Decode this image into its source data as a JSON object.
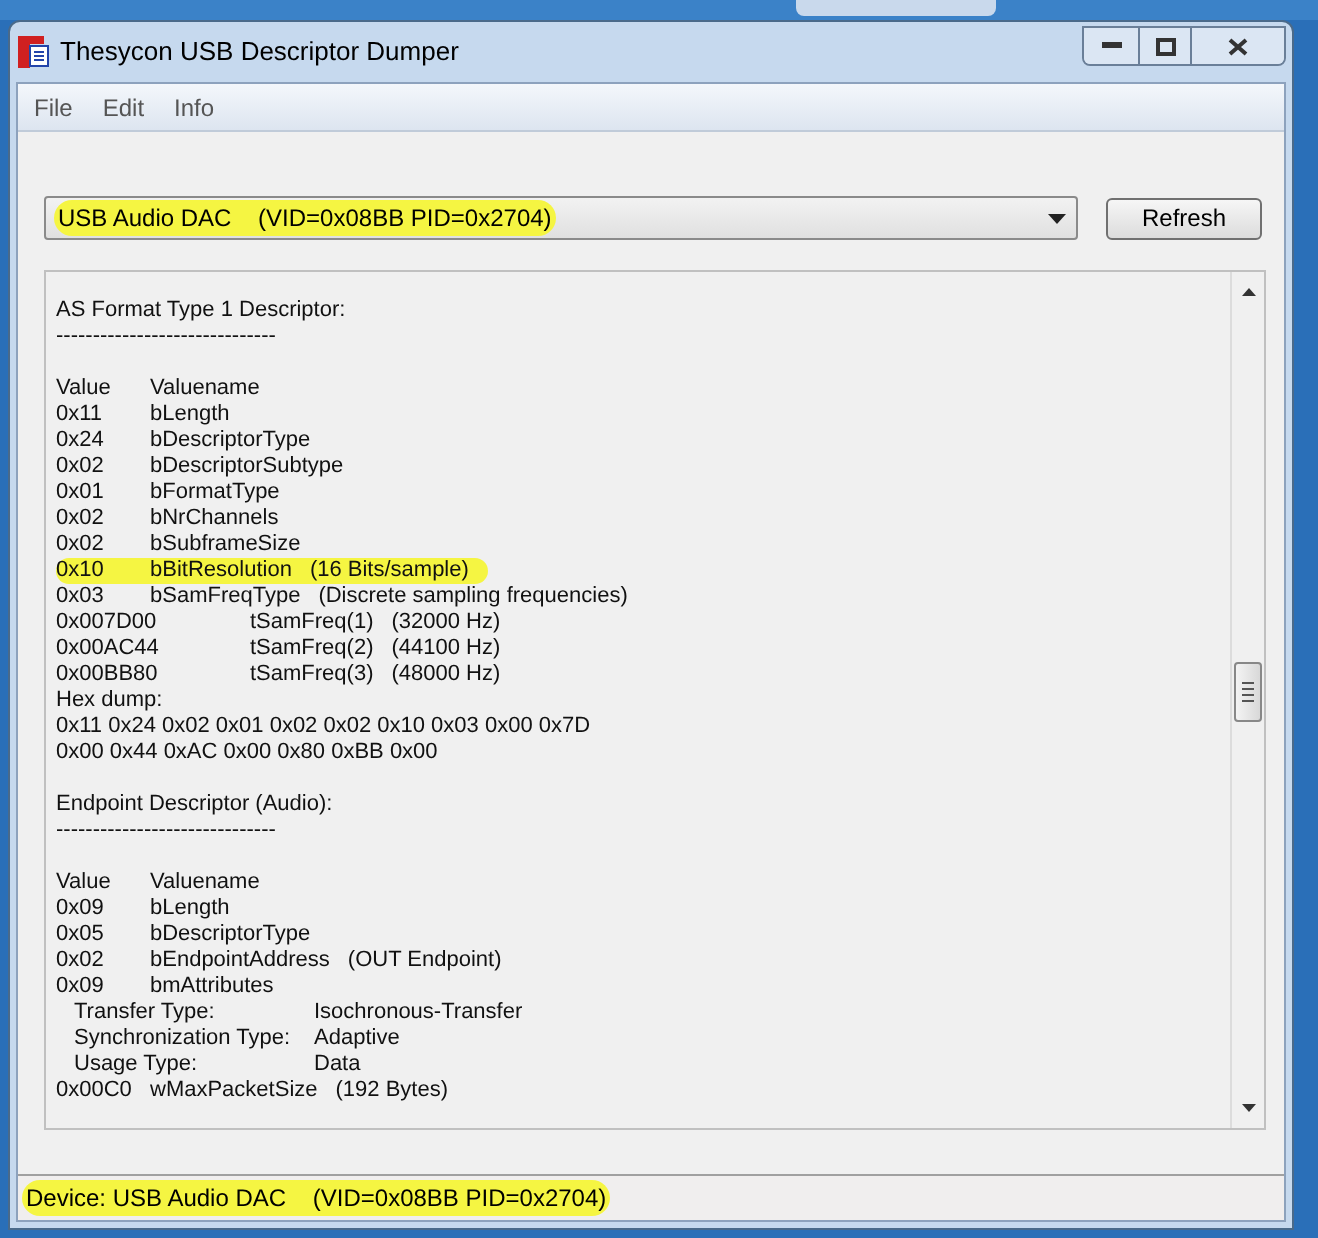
{
  "window": {
    "title": "Thesycon USB Descriptor Dumper"
  },
  "menu": [
    {
      "label": "File"
    },
    {
      "label": "Edit"
    },
    {
      "label": "Info"
    }
  ],
  "device_select": {
    "value": "USB Audio DAC    (VID=0x08BB PID=0x2704)",
    "highlighted": true
  },
  "refresh_button": {
    "label": "Refresh"
  },
  "output": [
    {
      "kind": "blank"
    },
    {
      "kind": "text",
      "text": "AS Format Type 1 Descriptor:"
    },
    {
      "kind": "text",
      "text": "------------------------------"
    },
    {
      "kind": "blank"
    },
    {
      "kind": "pair",
      "value": "Value",
      "name": "Valuename"
    },
    {
      "kind": "pair",
      "value": "0x11",
      "name": "bLength"
    },
    {
      "kind": "pair",
      "value": "0x24",
      "name": "bDescriptorType"
    },
    {
      "kind": "pair",
      "value": "0x02",
      "name": "bDescriptorSubtype"
    },
    {
      "kind": "pair",
      "value": "0x01",
      "name": "bFormatType"
    },
    {
      "kind": "pair",
      "value": "0x02",
      "name": "bNrChannels"
    },
    {
      "kind": "pair",
      "value": "0x02",
      "name": "bSubframeSize"
    },
    {
      "kind": "pair",
      "value": "0x10",
      "name": "bBitResolution",
      "note": "(16 Bits/sample)",
      "highlighted": true
    },
    {
      "kind": "pair",
      "value": "0x03",
      "name": "bSamFreqType",
      "note": "(Discrete sampling frequencies)"
    },
    {
      "kind": "wide",
      "value": "0x007D00",
      "name": "tSamFreq(1)",
      "note": "(32000 Hz)"
    },
    {
      "kind": "wide",
      "value": "0x00AC44",
      "name": "tSamFreq(2)",
      "note": "(44100 Hz)"
    },
    {
      "kind": "wide",
      "value": "0x00BB80",
      "name": "tSamFreq(3)",
      "note": "(48000 Hz)"
    },
    {
      "kind": "text",
      "text": "Hex dump:"
    },
    {
      "kind": "text",
      "text": "0x11 0x24 0x02 0x01 0x02 0x02 0x10 0x03 0x00 0x7D"
    },
    {
      "kind": "text",
      "text": "0x00 0x44 0xAC 0x00 0x80 0xBB 0x00"
    },
    {
      "kind": "blank"
    },
    {
      "kind": "text",
      "text": "Endpoint Descriptor (Audio):"
    },
    {
      "kind": "text",
      "text": "------------------------------"
    },
    {
      "kind": "blank"
    },
    {
      "kind": "pair",
      "value": "Value",
      "name": "Valuename"
    },
    {
      "kind": "pair",
      "value": "0x09",
      "name": "bLength"
    },
    {
      "kind": "pair",
      "value": "0x05",
      "name": "bDescriptorType"
    },
    {
      "kind": "pair",
      "value": "0x02",
      "name": "bEndpointAddress",
      "note": "(OUT Endpoint)"
    },
    {
      "kind": "pair",
      "value": "0x09",
      "name": "bmAttributes"
    },
    {
      "kind": "sub",
      "label": "Transfer Type:",
      "value": "Isochronous-Transfer"
    },
    {
      "kind": "sub",
      "label": "Synchronization Type:",
      "value": "Adaptive"
    },
    {
      "kind": "sub",
      "label": "Usage Type:",
      "value": "Data"
    },
    {
      "kind": "pair",
      "value": "0x00C0",
      "name": "wMaxPacketSize",
      "note": "(192 Bytes)"
    }
  ],
  "status_bar": {
    "text": "Device: USB Audio DAC    (VID=0x08BB PID=0x2704)",
    "highlighted": true
  }
}
